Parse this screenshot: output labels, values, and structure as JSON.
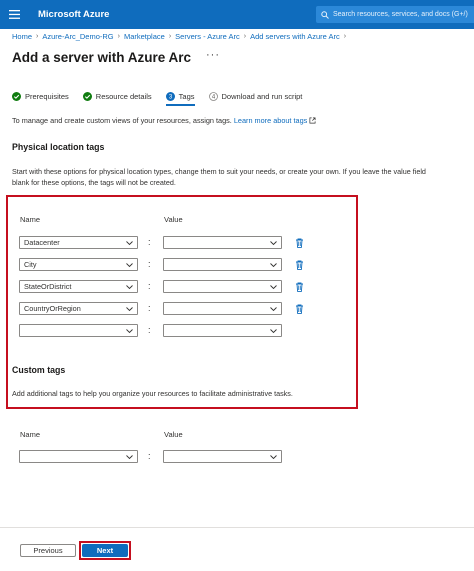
{
  "topbar": {
    "brand": "Microsoft Azure",
    "search_placeholder": "Search resources, services, and docs (G+/)"
  },
  "breadcrumb": [
    "Home",
    "Azure-Arc_Demo-RG",
    "Marketplace",
    "Servers - Azure Arc",
    "Add servers with Azure Arc"
  ],
  "page_title": "Add a server with Azure Arc",
  "more_label": "···",
  "steps": [
    {
      "label": "Prerequisites",
      "state": "done"
    },
    {
      "label": "Resource details",
      "state": "done"
    },
    {
      "label": "Tags",
      "number": "3",
      "state": "active"
    },
    {
      "label": "Download and run script",
      "number": "4",
      "state": "pending"
    }
  ],
  "intro": {
    "text": "To manage and create custom views of your resources, assign tags.",
    "link": "Learn more about tags"
  },
  "physical": {
    "title": "Physical location tags",
    "description_line1": "Start with these options for physical location types, change them to suit your needs, or create your own. If you leave the value field",
    "description_line2": "blank for these options, the tags will not be created.",
    "name_header": "Name",
    "value_header": "Value",
    "rows": [
      {
        "name": "Datacenter",
        "value": ""
      },
      {
        "name": "City",
        "value": ""
      },
      {
        "name": "StateOrDistrict",
        "value": ""
      },
      {
        "name": "CountryOrRegion",
        "value": ""
      },
      {
        "name": "",
        "value": ""
      }
    ],
    "separator": ":"
  },
  "custom": {
    "title": "Custom tags",
    "description": "Add additional tags to help you organize your resources to facilitate administrative tasks.",
    "name_header": "Name",
    "value_header": "Value",
    "rows": [
      {
        "name": "",
        "value": ""
      }
    ],
    "separator": ":"
  },
  "footer": {
    "previous": "Previous",
    "next": "Next"
  },
  "colors": {
    "accent": "#0f6cbd",
    "success": "#107c10",
    "highlight": "#c50f1f"
  }
}
